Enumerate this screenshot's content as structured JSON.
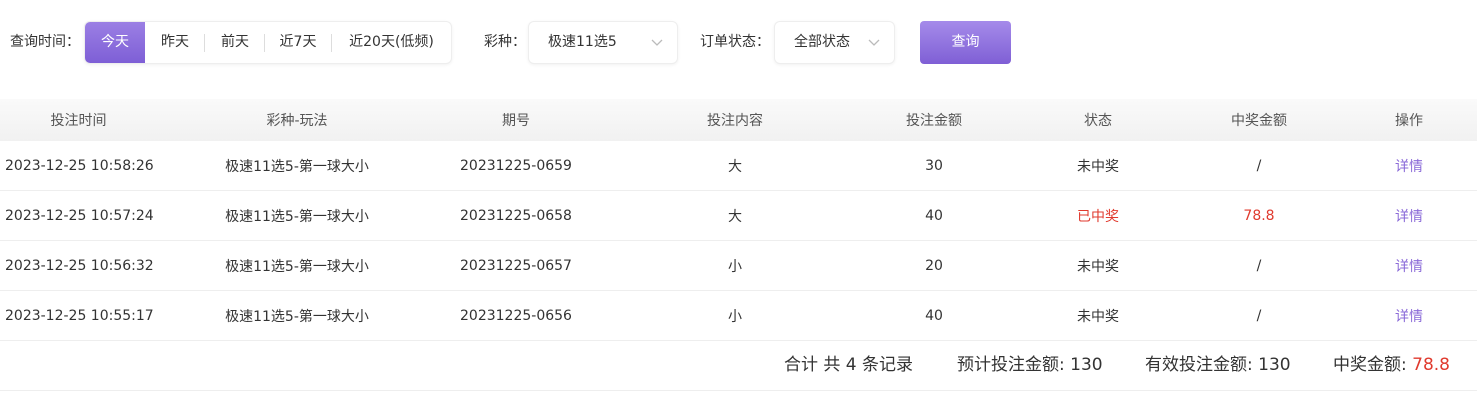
{
  "filters": {
    "time_label": "查询时间：",
    "time_options": [
      "今天",
      "昨天",
      "前天",
      "近7天",
      "近20天(低频)"
    ],
    "active_time": "今天",
    "lottery_label": "彩种：",
    "lottery_value": "极速11选5",
    "status_label": "订单状态：",
    "status_value": "全部状态",
    "query_button": "查询"
  },
  "table": {
    "columns": [
      "投注时间",
      "彩种-玩法",
      "期号",
      "投注内容",
      "投注金额",
      "状态",
      "中奖金额",
      "操作"
    ],
    "rows": [
      {
        "time": "2023-12-25 10:58:26",
        "game": "极速11选5-第一球大小",
        "issue": "20231225-0659",
        "content": "大",
        "amount": "30",
        "status": "未中奖",
        "win_amount": "/",
        "action": "详情"
      },
      {
        "time": "2023-12-25 10:57:24",
        "game": "极速11选5-第一球大小",
        "issue": "20231225-0658",
        "content": "大",
        "amount": "40",
        "status": "已中奖",
        "win_amount": "78.8",
        "action": "详情"
      },
      {
        "time": "2023-12-25 10:56:32",
        "game": "极速11选5-第一球大小",
        "issue": "20231225-0657",
        "content": "小",
        "amount": "20",
        "status": "未中奖",
        "win_amount": "/",
        "action": "详情"
      },
      {
        "time": "2023-12-25 10:55:17",
        "game": "极速11选5-第一球大小",
        "issue": "20231225-0656",
        "content": "小",
        "amount": "40",
        "status": "未中奖",
        "win_amount": "/",
        "action": "详情"
      }
    ]
  },
  "summary": {
    "total_text": "合计 共 4 条记录",
    "expected_label": "预计投注金额: ",
    "expected_value": "130",
    "effective_label": "有效投注金额: ",
    "effective_value": "130",
    "win_label": "中奖金额: ",
    "win_value": "78.8"
  },
  "colors": {
    "accent": "#8a6ad8",
    "win_red": "#e03a2e",
    "text": "#333333"
  }
}
